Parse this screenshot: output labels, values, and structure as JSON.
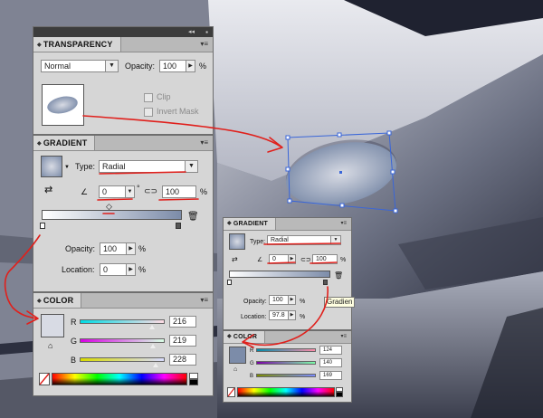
{
  "transparency": {
    "title": "TRANSPARENCY",
    "blend_mode": "Normal",
    "opacity_label": "Opacity:",
    "opacity_value": "100",
    "percent": "%",
    "clip_label": "Clip",
    "invert_mask_label": "Invert Mask"
  },
  "gradient_large": {
    "title": "GRADIENT",
    "type_label": "Type:",
    "type_value": "Radial",
    "angle_value": "0",
    "degree": "°",
    "aspect_value": "100",
    "percent": "%",
    "opacity_label": "Opacity:",
    "opacity_value": "100",
    "location_label": "Location:",
    "location_value": "0"
  },
  "color_large": {
    "title": "COLOR",
    "r_label": "R",
    "g_label": "G",
    "b_label": "B",
    "r_value": "216",
    "g_value": "219",
    "b_value": "228",
    "swatch_color": "#d8dbe4"
  },
  "gradient_small": {
    "title": "GRADIENT",
    "type_label": "Type:",
    "type_value": "Radial",
    "angle_value": "0",
    "aspect_value": "100",
    "percent": "%",
    "opacity_label": "Opacity:",
    "opacity_value": "100",
    "location_label": "Location:",
    "location_value": "97.8",
    "tooltip": "Gradien"
  },
  "color_small": {
    "title": "COLOR",
    "r_label": "R",
    "g_label": "G",
    "b_label": "B",
    "r_value": "124",
    "g_value": "140",
    "b_value": "169",
    "swatch_color": "#7c8ca9"
  },
  "icons": {
    "panel_collapse": "double-chevron-icon",
    "panel_menu": "panel-menu-icon",
    "dropdown": "chevron-down-icon",
    "trash": "trash-icon",
    "reverse": "reverse-gradient-icon",
    "angle": "angle-icon",
    "aspect": "aspect-ratio-icon",
    "none": "none-swatch-icon"
  },
  "colors": {
    "annotation_red": "#e0201c",
    "selection_blue": "#3a66d8",
    "panel_bg": "#d6d6d6",
    "title_bar": "#3c3c3c"
  }
}
